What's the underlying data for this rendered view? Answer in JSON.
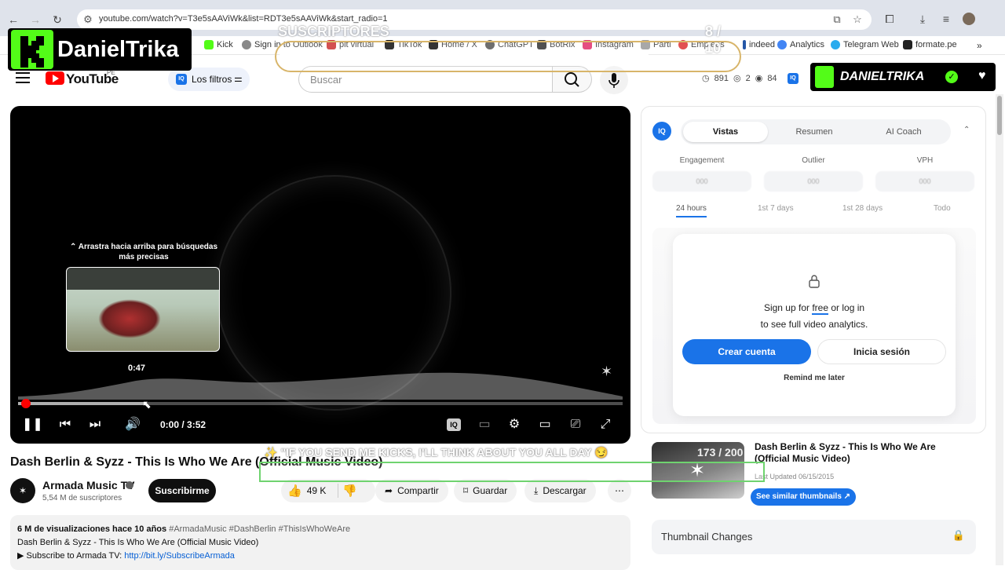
{
  "browser": {
    "url": "youtube.com/watch?v=T3e5sAAViWk&list=RDT3e5sAAViWk&start_radio=1",
    "bookmarks": [
      "Kick",
      "Sign in to Outlook",
      "pit virtual",
      "TikTok",
      "Home / X",
      "ChatGPT",
      "BotRix",
      "Instagram",
      "Parti",
      "Empleos",
      "indeed",
      "Analytics",
      "Telegram Web",
      "formate.pe"
    ]
  },
  "overlay": {
    "streamer_name": "DanielTrika",
    "badge_name": "DANIELTRIKA",
    "subs_goal_label": "SUSCRIPTORES",
    "subs_goal_count": "8 / 10",
    "kick_message": "\"IF YOU SEND ME KICKS, I'LL THINK ABOUT YOU ALL DAY",
    "kick_count": "173 / 200"
  },
  "header": {
    "logo_text": "YouTube",
    "region": "PE",
    "filters_label": "Los filtros",
    "search_placeholder": "Buscar",
    "stats": {
      "a": "891",
      "b": "2",
      "c": "84"
    }
  },
  "player": {
    "hint": "⌃ Arrastra hacia arriba para búsquedas más precisas",
    "preview_time": "0:47",
    "time_display": "0:00 / 3:52",
    "progress_fraction": 0.0,
    "hover_fraction": 0.212
  },
  "video": {
    "title": "Dash Berlin & Syzz - This Is Who We Are (Official Music Video)",
    "channel": "Armada Music TV",
    "subscribers": "5,54 M de suscriptores",
    "subscribe_label": "Suscribirme",
    "likes": "49 K",
    "share_label": "Compartir",
    "save_label": "Guardar",
    "download_label": "Descargar",
    "views_meta": "6 M de visualizaciones  hace 10 años",
    "hashtags": "#ArmadaMusic #DashBerlin #ThisIsWhoWeAre",
    "desc_line": "Dash Berlin & Syzz - This Is Who We Are (Official Music Video)",
    "subscribe_line": "▶ Subscribe to Armada TV:",
    "subscribe_link": "http://bit.ly/SubscribeArmada"
  },
  "panel": {
    "tabs": [
      "Vistas",
      "Resumen",
      "AI Coach"
    ],
    "metrics": [
      "Engagement",
      "Outlier",
      "VPH"
    ],
    "metric_values": [
      "000",
      "000",
      "000"
    ],
    "ranges": [
      "24 hours",
      "1st 7 days",
      "1st 28 days",
      "Todo"
    ],
    "lock_line1_pre": "Sign up for ",
    "lock_free": "free",
    "lock_line1_post": " or log in",
    "lock_line2": "to see full video analytics.",
    "create_label": "Crear cuenta",
    "login_label": "Inicia sesión",
    "remind_label": "Remind me later"
  },
  "similar": {
    "title": "Dash Berlin & Syzz - This Is Who We Are (Official Music Video)",
    "updated": "Last Updated 06/15/2015",
    "button": "See similar thumbnails ↗",
    "changes_label": "Thumbnail Changes"
  },
  "colors": {
    "accent": "#1a73e8",
    "kick": "#53fc18",
    "yt_red": "#ff0000"
  }
}
